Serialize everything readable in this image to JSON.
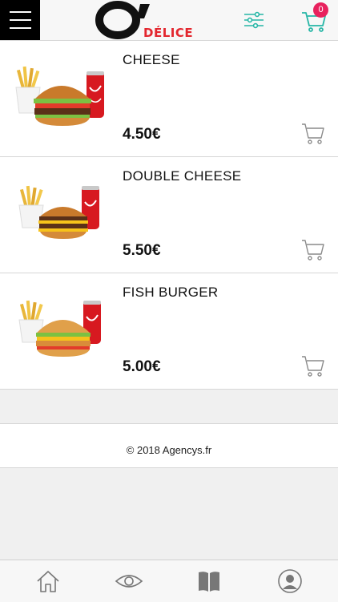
{
  "header": {
    "brand_big": "O'",
    "brand_small": "DÉLICE",
    "cart_count": "0"
  },
  "products": [
    {
      "name": "CHEESE",
      "price": "4.50€"
    },
    {
      "name": "DOUBLE CHEESE",
      "price": "5.50€"
    },
    {
      "name": "FISH BURGER",
      "price": "5.00€"
    }
  ],
  "footer": {
    "copyright": "© 2018 Agencys.fr"
  },
  "tabbar": {
    "items": [
      "home-icon",
      "eye-icon",
      "book-icon",
      "user-icon"
    ]
  },
  "colors": {
    "accent": "#26b6a6",
    "badge": "#e8215d",
    "brand_red": "#e3262e"
  }
}
